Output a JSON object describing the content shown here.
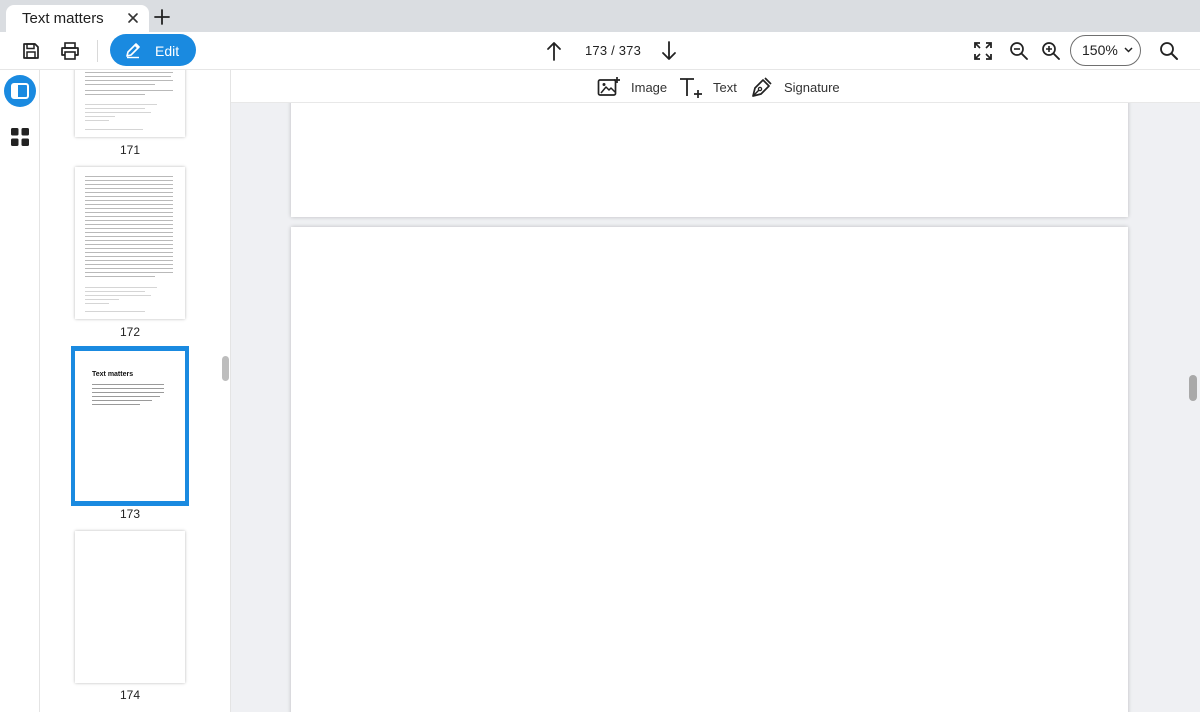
{
  "tab": {
    "title": "Text matters"
  },
  "toolbar": {
    "edit_label": "Edit",
    "page_indicator": "173 / 373",
    "zoom": "150%"
  },
  "edit_tools": {
    "image_label": "Image",
    "text_label": "Text",
    "signature_label": "Signature"
  },
  "thumbnails": [
    {
      "number": "171"
    },
    {
      "number": "172"
    },
    {
      "number": "173",
      "heading": "Text matters",
      "selected": true
    },
    {
      "number": "174"
    }
  ],
  "colors": {
    "accent": "#1a8ae0",
    "doc_background": "#eff0f3"
  }
}
